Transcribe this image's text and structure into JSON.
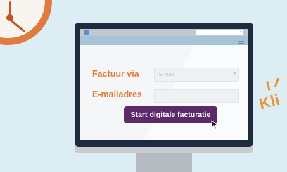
{
  "form": {
    "invoice_via_label": "Factuur via",
    "invoice_via_placeholder": "E-mail",
    "email_label": "E-mailadres",
    "email_value": "",
    "start_button_label": "Start digitale facturatie"
  },
  "side_text": "Kli",
  "colors": {
    "background": "#dcedf4",
    "accent_orange": "#e57b34",
    "button_purple": "#5c2a6b",
    "monitor_frame": "#1e2a3e"
  },
  "icons": [
    "clock-icon",
    "mouse-pointer-icon",
    "chevron-down-icon",
    "menu-icon"
  ]
}
